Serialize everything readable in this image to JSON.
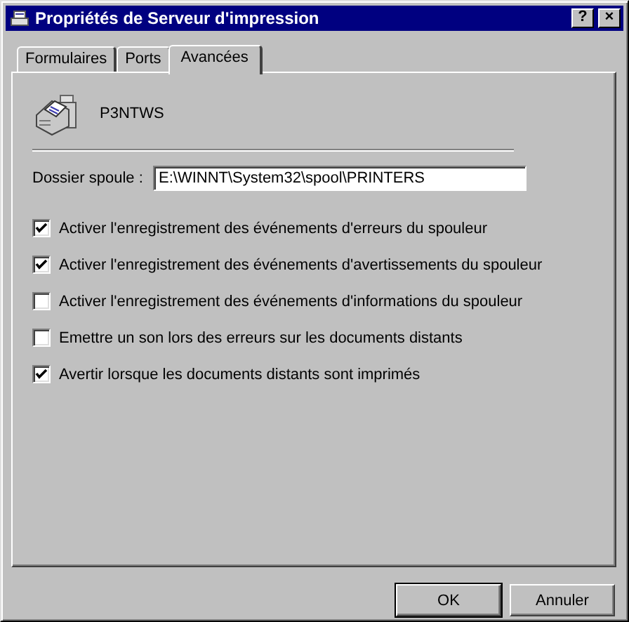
{
  "window": {
    "title": "Propriétés de Serveur d'impression",
    "help_button": "?",
    "close_button": "×"
  },
  "tabs": [
    {
      "label": "Formulaires",
      "selected": false
    },
    {
      "label": "Ports",
      "selected": false
    },
    {
      "label": "Avancées",
      "selected": true
    }
  ],
  "server": {
    "name": "P3NTWS"
  },
  "spool_folder": {
    "label": "Dossier spoule :",
    "value": "E:\\WINNT\\System32\\spool\\PRINTERS"
  },
  "options": [
    {
      "label": "Activer l'enregistrement des événements d'erreurs du spouleur",
      "checked": true
    },
    {
      "label": "Activer l'enregistrement des événements d'avertissements du spouleur",
      "checked": true
    },
    {
      "label": "Activer l'enregistrement des événements d'informations du spouleur",
      "checked": false
    },
    {
      "label": "Emettre un son lors des erreurs sur les documents distants",
      "checked": false
    },
    {
      "label": "Avertir lorsque les documents distants sont imprimés",
      "checked": true
    }
  ],
  "buttons": [
    {
      "label": "OK",
      "default": true
    },
    {
      "label": "Annuler",
      "default": false
    }
  ]
}
